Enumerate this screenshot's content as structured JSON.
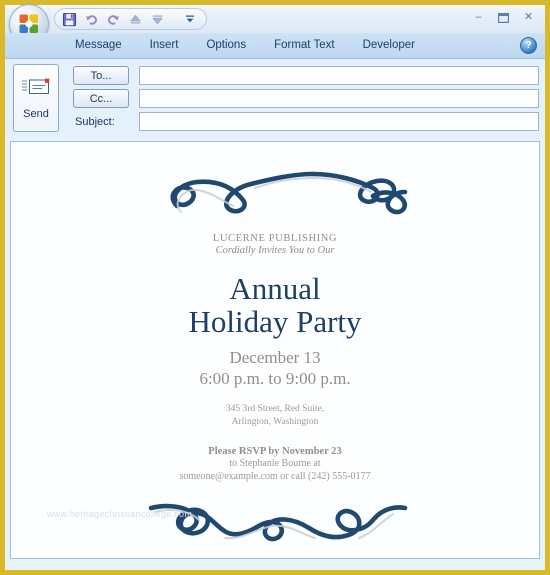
{
  "window": {
    "border_color": "#d9b82a",
    "chrome_bg": "#e4f0fb"
  },
  "titlebar": {
    "office_button": "Office Button",
    "quick_access": [
      {
        "name": "save-icon",
        "label": "Save"
      },
      {
        "name": "undo-icon",
        "label": "Undo"
      },
      {
        "name": "redo-icon",
        "label": "Redo"
      },
      {
        "name": "previous-item-icon",
        "label": "Previous Item"
      },
      {
        "name": "next-item-icon",
        "label": "Next Item"
      },
      {
        "name": "customize-quick-access-icon",
        "label": "Customize Quick Access Toolbar"
      }
    ],
    "window_controls": {
      "minimize": "–",
      "maximize": "❐",
      "close": "✕"
    }
  },
  "ribbon": {
    "tabs": [
      {
        "label": "Message"
      },
      {
        "label": "Insert"
      },
      {
        "label": "Options"
      },
      {
        "label": "Format Text"
      },
      {
        "label": "Developer"
      }
    ],
    "help_glyph": "?",
    "help_label": "Help"
  },
  "compose": {
    "send_label": "Send",
    "send_icon": "envelope-send-icon",
    "to_label": "To...",
    "cc_label": "Cc...",
    "subject_label": "Subject:",
    "to_value": "",
    "cc_value": "",
    "subject_value": "",
    "to_placeholder": "",
    "cc_placeholder": "",
    "subject_placeholder": ""
  },
  "invitation": {
    "accent_color": "#1f3f66",
    "muted_color": "#8e8e8e",
    "organization": "LUCERNE PUBLISHING",
    "cordially": "Cordially Invites You to Our",
    "title_line1": "Annual",
    "title_line2": "Holiday Party",
    "date": "December 13",
    "time": "6:00 p.m. to 9:00 p.m.",
    "address_line1": "345 3rd Street, Red Suite,",
    "address_line2": "Arlington, Washington",
    "rsvp_line1": "Please RSVP by November 23",
    "rsvp_line2": "to  Stephanie Bourne at",
    "rsvp_line3": "someone@example.com or call (242) 555-0177",
    "top_ornament": "flourish-ornament-top",
    "bottom_ornament": "flourish-ornament-bottom",
    "watermark": "www.heritagechristiancollege.com"
  }
}
